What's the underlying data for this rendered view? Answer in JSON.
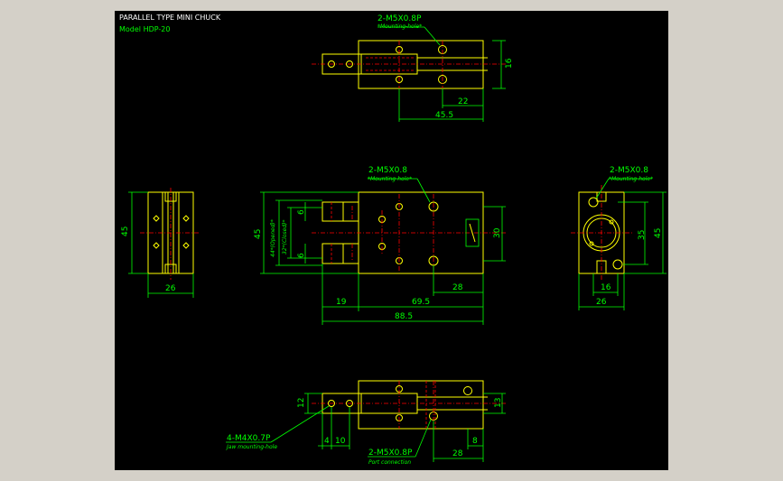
{
  "drawing": {
    "title": "PARALLEL TYPE MINI CHUCK",
    "model": "Model  HDP-20"
  },
  "top_view": {
    "callout": "2-M5X0.8P",
    "callout_note": "*Mounting-hole*",
    "dim_16": "16",
    "dim_22": "22",
    "dim_45_5": "45.5"
  },
  "front_view": {
    "callout": "2-M5X0.8",
    "callout_note": "*Mounting-hole*",
    "dim_6a": "6",
    "dim_6b": "6",
    "dim_open": "44*(Opened)*",
    "dim_closed": "32*(Closed)*",
    "dim_45": "45",
    "dim_30": "30",
    "dim_19": "19",
    "dim_69_5": "69.5",
    "dim_28": "28",
    "dim_88_5": "88.5"
  },
  "left_view": {
    "dim_45": "45",
    "dim_26": "26"
  },
  "right_view": {
    "callout": "2-M5X0.8",
    "callout_note": "*Mounting-hole*",
    "dim_35": "35",
    "dim_45": "45",
    "dim_16": "16",
    "dim_26": "26"
  },
  "bottom_view": {
    "dim_12": "12",
    "dim_13": "13",
    "dim_4": "4",
    "dim_10": "10",
    "dim_8": "8",
    "dim_28": "28",
    "callout_left": "4-M4X0.7P",
    "callout_left_note": "Jaw mounting-hole",
    "callout_port": "2-M5X0.8P",
    "callout_port_note": "Port connection"
  },
  "colors": {
    "background": "#000000",
    "outline": "#ffff00",
    "dimension": "#00ff00",
    "centerline": "#ff0000",
    "frame": "#d4d0c8"
  }
}
